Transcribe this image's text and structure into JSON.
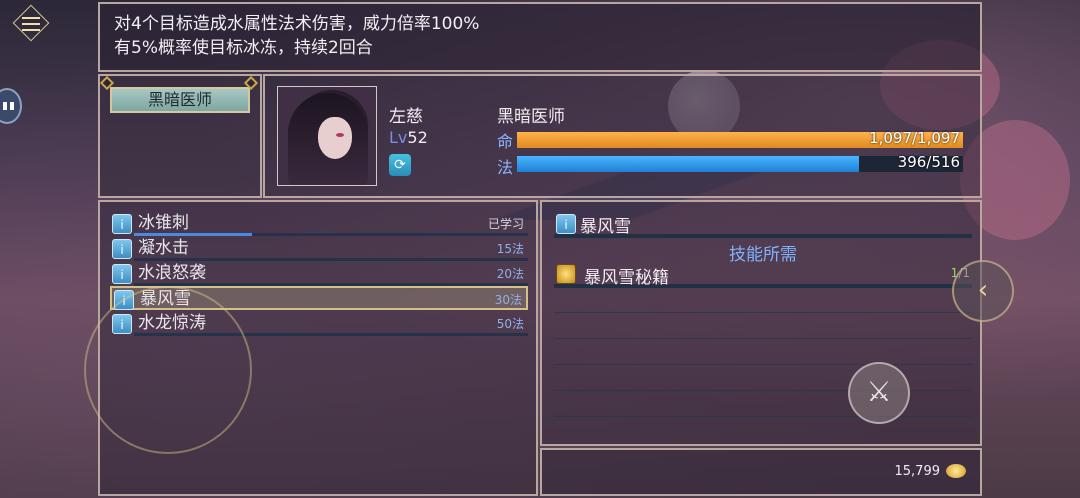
{
  "description": {
    "line1": "对4个目标造成水属性法术伤害，威力倍率100%",
    "line2": "有5%概率使目标冰冻，持续2回合"
  },
  "class_panel": {
    "label": "黑暗医师"
  },
  "character": {
    "name": "左慈",
    "level_prefix": "Lv",
    "level": "52",
    "class": "黑暗医师",
    "hp_label": "命",
    "hp_text": "1,097/1,097",
    "hp_fraction": 1.0,
    "mp_label": "法",
    "mp_text": "396/516",
    "mp_fraction": 0.767,
    "refresh_icon": "refresh-icon"
  },
  "skills": [
    {
      "name": "冰锥刺",
      "status": "已学习",
      "learned": true,
      "selected": false
    },
    {
      "name": "凝水击",
      "status": "15法",
      "learned": false,
      "selected": false
    },
    {
      "name": "水浪怒袭",
      "status": "20法",
      "learned": false,
      "selected": false
    },
    {
      "name": "暴风雪",
      "status": "30法",
      "learned": false,
      "selected": true
    },
    {
      "name": "水龙惊涛",
      "status": "50法",
      "learned": false,
      "selected": false
    }
  ],
  "detail": {
    "skill_name": "暴风雪",
    "requirements_title": "技能所需",
    "requirement_item": "暴风雪秘籍",
    "requirement_have": "1",
    "requirement_need": "/1"
  },
  "currency": {
    "gold": "15,799",
    "icon": "gold-coin-icon"
  },
  "colors": {
    "hp": "#f0a030",
    "mp": "#3a9ef0",
    "accent_border": "#b7a7a0",
    "req_title": "#7fb2ff"
  }
}
